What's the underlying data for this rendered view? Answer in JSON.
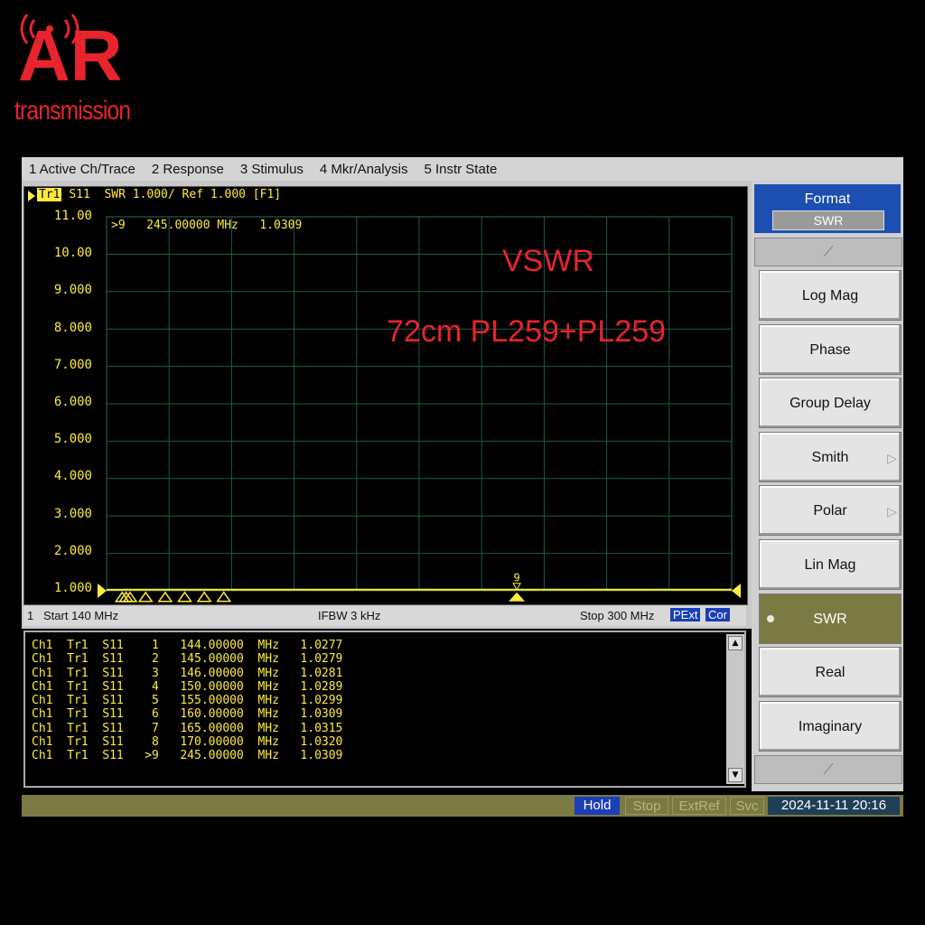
{
  "logo": {
    "letters": "AR",
    "text": "transmission",
    "brand_color": "#e8242c",
    "icon": "radio-tower-icon"
  },
  "menubar": {
    "items": [
      "1 Active Ch/Trace",
      "2 Response",
      "3 Stimulus",
      "4 Mkr/Analysis",
      "5 Instr State"
    ]
  },
  "trace": {
    "tag": "Tr1",
    "header": "S11  SWR 1.000/ Ref 1.000 [F1]",
    "marker_readout": ">9   245.00000 MHz   1.0309"
  },
  "annotations": {
    "vswr": "VSWR",
    "cable": "72cm PL259+PL259"
  },
  "chart_data": {
    "type": "line",
    "yticks": [
      "11.00",
      "10.00",
      "9.000",
      "8.000",
      "7.000",
      "6.000",
      "5.000",
      "4.000",
      "3.000",
      "2.000",
      "1.000"
    ],
    "ylim": [
      1.0,
      11.0
    ],
    "xlim": [
      140,
      300
    ],
    "x_unit": "MHz",
    "grid": true,
    "trace_color": "#ffeb3b",
    "x": [
      140,
      144,
      145,
      146,
      150,
      155,
      160,
      165,
      170,
      245,
      300
    ],
    "y": [
      1.027,
      1.0277,
      1.0279,
      1.0281,
      1.0289,
      1.0299,
      1.0309,
      1.0315,
      1.032,
      1.0309,
      1.03
    ],
    "markers": [
      {
        "id": "1",
        "x": 144,
        "y": 1.0277
      },
      {
        "id": "2",
        "x": 145,
        "y": 1.0279
      },
      {
        "id": "3",
        "x": 146,
        "y": 1.0281
      },
      {
        "id": "4",
        "x": 150,
        "y": 1.0289
      },
      {
        "id": "5",
        "x": 155,
        "y": 1.0299
      },
      {
        "id": "6",
        "x": 160,
        "y": 1.0309
      },
      {
        "id": "7",
        "x": 165,
        "y": 1.0315
      },
      {
        "id": "8",
        "x": 170,
        "y": 1.032
      },
      {
        "id": "9",
        "x": 245,
        "y": 1.0309,
        "active": true
      }
    ]
  },
  "stimulus": {
    "channel": "1",
    "start": "Start 140 MHz",
    "ifbw": "IFBW 3 kHz",
    "stop": "Stop 300 MHz",
    "badge1": "PExt",
    "badge2": "Cor"
  },
  "marker_table": {
    "rows": [
      "Ch1  Tr1  S11    1   144.00000  MHz   1.0277",
      "Ch1  Tr1  S11    2   145.00000  MHz   1.0279",
      "Ch1  Tr1  S11    3   146.00000  MHz   1.0281",
      "Ch1  Tr1  S11    4   150.00000  MHz   1.0289",
      "Ch1  Tr1  S11    5   155.00000  MHz   1.0299",
      "Ch1  Tr1  S11    6   160.00000  MHz   1.0309",
      "Ch1  Tr1  S11    7   165.00000  MHz   1.0315",
      "Ch1  Tr1  S11    8   170.00000  MHz   1.0320",
      "Ch1  Tr1  S11   >9   245.00000  MHz   1.0309"
    ]
  },
  "softkeys": {
    "title": "Format",
    "value": "SWR",
    "items": [
      "Log Mag",
      "Phase",
      "Group Delay",
      "Smith",
      "Polar",
      "Lin Mag",
      "SWR",
      "Real",
      "Imaginary"
    ],
    "selected": "SWR"
  },
  "status": {
    "hold": "Hold",
    "stop": "Stop",
    "extref": "ExtRef",
    "svc": "Svc",
    "datetime": "2024-11-11 20:16"
  }
}
